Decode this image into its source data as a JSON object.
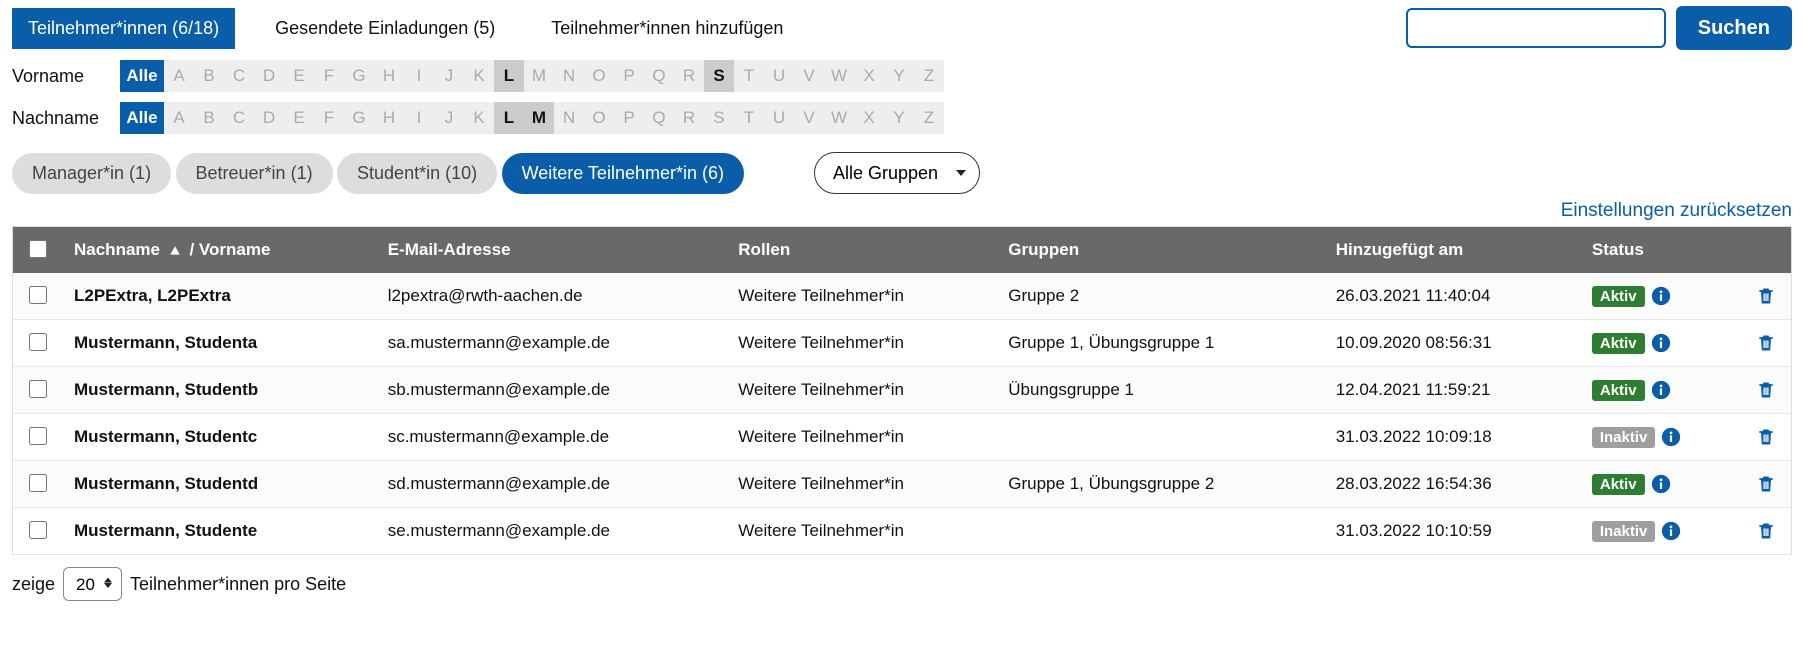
{
  "tabs": [
    {
      "label": "Teilnehmer*innen (6/18)",
      "active": true
    },
    {
      "label": "Gesendete Einladungen (5)",
      "active": false
    },
    {
      "label": "Teilnehmer*innen hinzufügen",
      "active": false
    }
  ],
  "search": {
    "button": "Suchen",
    "value": ""
  },
  "alphabetFilters": {
    "vorname": {
      "label": "Vorname",
      "all": "Alle",
      "letters": [
        "A",
        "B",
        "C",
        "D",
        "E",
        "F",
        "G",
        "H",
        "I",
        "J",
        "K",
        "L",
        "M",
        "N",
        "O",
        "P",
        "Q",
        "R",
        "S",
        "T",
        "U",
        "V",
        "W",
        "X",
        "Y",
        "Z"
      ],
      "selected": [
        "L",
        "S"
      ],
      "allActive": true
    },
    "nachname": {
      "label": "Nachname",
      "all": "Alle",
      "letters": [
        "A",
        "B",
        "C",
        "D",
        "E",
        "F",
        "G",
        "H",
        "I",
        "J",
        "K",
        "L",
        "M",
        "N",
        "O",
        "P",
        "Q",
        "R",
        "S",
        "T",
        "U",
        "V",
        "W",
        "X",
        "Y",
        "Z"
      ],
      "selected": [
        "L",
        "M"
      ],
      "allActive": true
    }
  },
  "rolePills": [
    {
      "label": "Manager*in (1)",
      "active": false
    },
    {
      "label": "Betreuer*in (1)",
      "active": false
    },
    {
      "label": "Student*in (10)",
      "active": false
    },
    {
      "label": "Weitere Teilnehmer*in (6)",
      "active": true
    }
  ],
  "groupSelect": {
    "value": "Alle Gruppen"
  },
  "resetLink": "Einstellungen zurücksetzen",
  "table": {
    "headers": {
      "name": "Nachname",
      "nameSep": " / ",
      "firstname": "Vorname",
      "email": "E-Mail-Adresse",
      "roles": "Rollen",
      "groups": "Gruppen",
      "added": "Hinzugefügt am",
      "status": "Status"
    },
    "statusLabels": {
      "active": "Aktiv",
      "inactive": "Inaktiv"
    },
    "rows": [
      {
        "name": "L2PExtra, L2PExtra",
        "email": "l2pextra@rwth-aachen.de",
        "roles": "Weitere Teilnehmer*in",
        "groups": "Gruppe 2",
        "added": "26.03.2021 11:40:04",
        "status": "active"
      },
      {
        "name": "Mustermann, Studenta",
        "email": "sa.mustermann@example.de",
        "roles": "Weitere Teilnehmer*in",
        "groups": "Gruppe 1, Übungsgruppe 1",
        "added": "10.09.2020 08:56:31",
        "status": "active"
      },
      {
        "name": "Mustermann, Studentb",
        "email": "sb.mustermann@example.de",
        "roles": "Weitere Teilnehmer*in",
        "groups": "Übungsgruppe 1",
        "added": "12.04.2021 11:59:21",
        "status": "active"
      },
      {
        "name": "Mustermann, Studentc",
        "email": "sc.mustermann@example.de",
        "roles": "Weitere Teilnehmer*in",
        "groups": "",
        "added": "31.03.2022 10:09:18",
        "status": "inactive"
      },
      {
        "name": "Mustermann, Studentd",
        "email": "sd.mustermann@example.de",
        "roles": "Weitere Teilnehmer*in",
        "groups": "Gruppe 1, Übungsgruppe 2",
        "added": "28.03.2022 16:54:36",
        "status": "active"
      },
      {
        "name": "Mustermann, Studente",
        "email": "se.mustermann@example.de",
        "roles": "Weitere Teilnehmer*in",
        "groups": "",
        "added": "31.03.2022 10:10:59",
        "status": "inactive"
      }
    ]
  },
  "pagination": {
    "prefix": "zeige",
    "perPage": "20",
    "suffix": "Teilnehmer*innen pro Seite"
  }
}
